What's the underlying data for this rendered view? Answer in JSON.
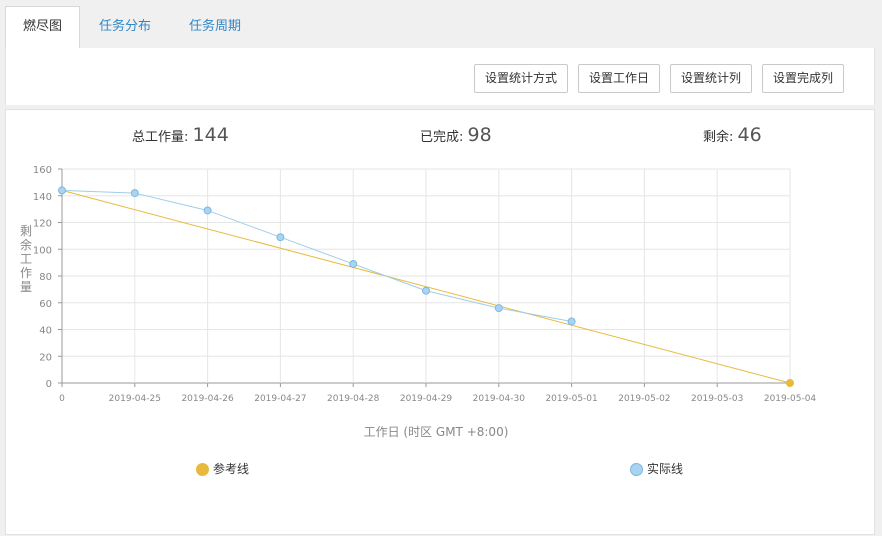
{
  "tabs": [
    {
      "label": "燃尽图"
    },
    {
      "label": "任务分布"
    },
    {
      "label": "任务周期"
    }
  ],
  "toolbar": {
    "buttons": [
      {
        "label": "设置统计方式"
      },
      {
        "label": "设置工作日"
      },
      {
        "label": "设置统计列"
      },
      {
        "label": "设置完成列"
      }
    ]
  },
  "stats": {
    "total_label": "总工作量:",
    "total_value": "144",
    "done_label": "已完成:",
    "done_value": "98",
    "remaining_label": "剩余:",
    "remaining_value": "46"
  },
  "colors": {
    "reference": "#e8b93d",
    "actual": "#a9d3f1",
    "actual_stroke": "#7db8e2"
  },
  "chart_data": {
    "type": "line",
    "xlabel": "工作日 (时区 GMT +8:00)",
    "ylabel": "剩余工作量",
    "ylim": [
      0,
      160
    ],
    "yticks": [
      0,
      20,
      40,
      60,
      80,
      100,
      120,
      140,
      160
    ],
    "categories": [
      "0",
      "2019-04-25",
      "2019-04-26",
      "2019-04-27",
      "2019-04-28",
      "2019-04-29",
      "2019-04-30",
      "2019-05-01",
      "2019-05-02",
      "2019-05-03",
      "2019-05-04"
    ],
    "grid": true,
    "series": [
      {
        "name": "参考线",
        "values": [
          144,
          null,
          null,
          null,
          null,
          null,
          null,
          null,
          null,
          null,
          0
        ]
      },
      {
        "name": "实际线",
        "values": [
          144,
          142,
          129,
          109,
          89,
          69,
          56,
          46,
          null,
          null,
          null
        ]
      }
    ],
    "legend": "bottom"
  }
}
